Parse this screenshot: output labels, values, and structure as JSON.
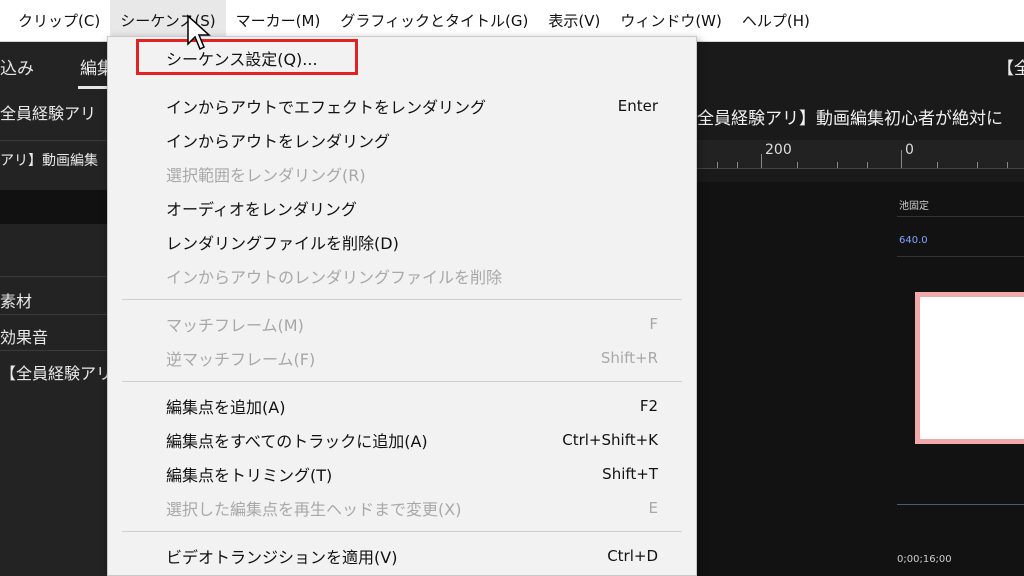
{
  "menubar": {
    "items": [
      "クリップ(C)",
      "シーケンス(S)",
      "マーカー(M)",
      "グラフィックとタイトル(G)",
      "表示(V)",
      "ウィンドウ(W)",
      "ヘルプ(H)"
    ]
  },
  "left_panel": {
    "tabs": [
      "込み",
      "編集"
    ],
    "rows": [
      "全員経験アリ",
      "アリ】動画編集",
      "素材",
      "効果音",
      "【全員経験アリ"
    ]
  },
  "right_panel": {
    "title_fragment": "【全",
    "sequence_name": "全員経験アリ】動画編集初心者が絶対に",
    "ruler_labels": [
      "200",
      "0"
    ],
    "tiny_label_1": "池固定",
    "tiny_label_2": "640.0",
    "timecode": "0;00;16;00"
  },
  "dropdown": {
    "highlighted_label": "シーケンス設定(Q)...",
    "groups": [
      [
        {
          "label": "インからアウトでエフェクトをレンダリング",
          "shortcut": "Enter",
          "enabled": true
        },
        {
          "label": "インからアウトをレンダリング",
          "shortcut": "",
          "enabled": true
        },
        {
          "label": "選択範囲をレンダリング(R)",
          "shortcut": "",
          "enabled": false
        },
        {
          "label": "オーディオをレンダリング",
          "shortcut": "",
          "enabled": true
        },
        {
          "label": "レンダリングファイルを削除(D)",
          "shortcut": "",
          "enabled": true
        },
        {
          "label": "インからアウトのレンダリングファイルを削除",
          "shortcut": "",
          "enabled": false
        }
      ],
      [
        {
          "label": "マッチフレーム(M)",
          "shortcut": "F",
          "enabled": false
        },
        {
          "label": "逆マッチフレーム(F)",
          "shortcut": "Shift+R",
          "enabled": false
        }
      ],
      [
        {
          "label": "編集点を追加(A)",
          "shortcut": "F2",
          "enabled": true
        },
        {
          "label": "編集点をすべてのトラックに追加(A)",
          "shortcut": "Ctrl+Shift+K",
          "enabled": true
        },
        {
          "label": "編集点をトリミング(T)",
          "shortcut": "Shift+T",
          "enabled": true
        },
        {
          "label": "選択した編集点を再生ヘッドまで変更(X)",
          "shortcut": "E",
          "enabled": false
        }
      ],
      [
        {
          "label": "ビデオトランジションを適用(V)",
          "shortcut": "Ctrl+D",
          "enabled": true
        }
      ]
    ]
  },
  "colors": {
    "highlight_border": "#e02222",
    "menu_bg": "#f2f2f2",
    "disabled_text": "#a8a8a8",
    "app_bg": "#1e1e1e"
  }
}
